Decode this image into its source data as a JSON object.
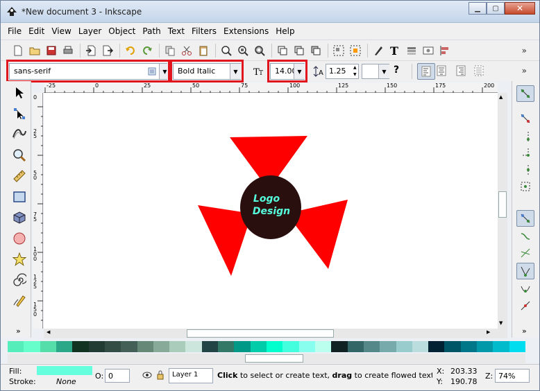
{
  "window": {
    "title": "*New document 3 - Inkscape"
  },
  "menu": [
    "File",
    "Edit",
    "View",
    "Layer",
    "Object",
    "Path",
    "Text",
    "Filters",
    "Extensions",
    "Help"
  ],
  "text_toolbar": {
    "font_family": "sans-serif",
    "font_style": "Bold Italic",
    "font_size": "14.000",
    "line_spacing": "1.25"
  },
  "ruler_h_labels": [
    "-25",
    "0",
    "25",
    "50",
    "75",
    "100",
    "125",
    "150",
    "175",
    "200"
  ],
  "ruler_v_labels": [
    "0",
    "25",
    "50",
    "75",
    "100",
    "125",
    "150"
  ],
  "canvas": {
    "logo_line1": "Logo",
    "logo_line2": "Design",
    "colors": {
      "triangles": "#ff0000",
      "circle": "#2a0f0f",
      "text": "#55ffdd"
    }
  },
  "status": {
    "fill_label": "Fill:",
    "stroke_label": "Stroke:",
    "stroke_value": "None",
    "fill_color": "#66ffdd",
    "opacity_label": "O:",
    "opacity_value": "0",
    "layer": "Layer 1",
    "message_bold1": "Click",
    "message_part1": " to select or create text, ",
    "message_bold2": "drag",
    "message_part2": " to create flowed text; th...",
    "x_label": "X:",
    "x_value": "203.33",
    "y_label": "Y:",
    "y_value": "190.78",
    "z_label": "Z:",
    "zoom": "74%"
  },
  "palette_colors": [
    "#55eebb",
    "#66ffcc",
    "#55ddaa",
    "#2aa888",
    "#113322",
    "#223b33",
    "#334d44",
    "#445f55",
    "#668877",
    "#88aa99",
    "#aaccbb",
    "#cce5dd",
    "#224444",
    "#337766",
    "#009988",
    "#00ccaa",
    "#00ffcc",
    "#44ffdd",
    "#88ffee",
    "#bbffee",
    "#112222",
    "#336666",
    "#558888",
    "#77aaaa",
    "#99cccc",
    "#bbdddd",
    "#002233",
    "#005566",
    "#007788",
    "#0099aa",
    "#00bbcc",
    "#00ddee"
  ]
}
